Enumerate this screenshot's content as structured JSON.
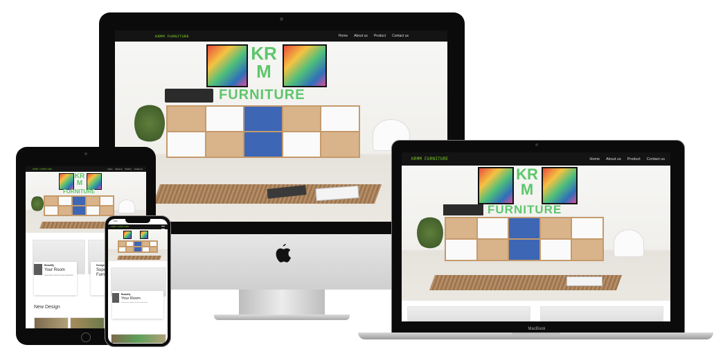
{
  "site": {
    "brand": "KRMM FURNITURE",
    "menu": [
      "Home",
      "About us",
      "Product",
      "Contact us"
    ],
    "hero_letters": "KR\nM",
    "hero_word": "FURNITURE",
    "card_small": "Beautify",
    "card_title": "Your Room",
    "card_text": "Lorem ipsum dolor sit amet consectetur",
    "section_title": "New Design",
    "card2_small": "Design",
    "card2_title": "Super",
    "card2_title2": "Furni",
    "phone_time": "9:41"
  },
  "devices": {
    "laptop_label": "MacBook",
    "imac_logo": "apple-logo"
  },
  "colors": {
    "brand_green": "#7ed321",
    "nav_bg": "#141414",
    "device_black": "#0b0b0b"
  }
}
